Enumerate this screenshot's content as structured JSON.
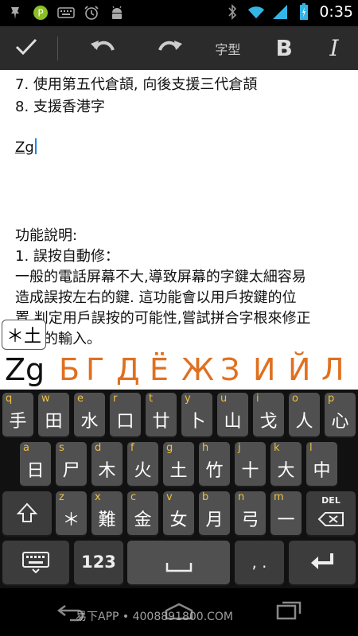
{
  "status": {
    "time": "0:35",
    "battery_color": "#33b5e5"
  },
  "toolbar": {
    "font_label": "字型",
    "bold_label": "B",
    "italic_label": "I"
  },
  "document": {
    "lines": [
      "7. 使用第五代倉頡, 向後支援三代倉頡",
      "8. 支援香港字",
      "Zg",
      "功能說明:",
      "1. 誤按自動修：",
      "一般的電話屏幕不大,導致屏幕的字鍵太細容易",
      "造成誤按左右的鍵. 這功能會以用戶按鍵的位",
      "置,判定用戶誤按的可能性,嘗試拼合字根來修正",
      "用戶的輸入。"
    ]
  },
  "composing": {
    "text": "＊土"
  },
  "candidates": [
    "Zg",
    "Б",
    "Г",
    "Д",
    "Ё",
    "Ж",
    "З",
    "И",
    "Й",
    "Л"
  ],
  "keyboard": {
    "row1": [
      {
        "hint": "q",
        "label": "手"
      },
      {
        "hint": "w",
        "label": "田"
      },
      {
        "hint": "e",
        "label": "水"
      },
      {
        "hint": "r",
        "label": "口"
      },
      {
        "hint": "t",
        "label": "廿"
      },
      {
        "hint": "y",
        "label": "卜"
      },
      {
        "hint": "u",
        "label": "山"
      },
      {
        "hint": "i",
        "label": "戈"
      },
      {
        "hint": "o",
        "label": "人"
      },
      {
        "hint": "p",
        "label": "心"
      }
    ],
    "row2": [
      {
        "hint": "a",
        "label": "日"
      },
      {
        "hint": "s",
        "label": "尸"
      },
      {
        "hint": "d",
        "label": "木"
      },
      {
        "hint": "f",
        "label": "火"
      },
      {
        "hint": "g",
        "label": "土"
      },
      {
        "hint": "h",
        "label": "竹"
      },
      {
        "hint": "j",
        "label": "十"
      },
      {
        "hint": "k",
        "label": "大"
      },
      {
        "hint": "l",
        "label": "中"
      }
    ],
    "row3": [
      {
        "hint": "z",
        "label": "＊"
      },
      {
        "hint": "x",
        "label": "難"
      },
      {
        "hint": "c",
        "label": "金"
      },
      {
        "hint": "v",
        "label": "女"
      },
      {
        "hint": "b",
        "label": "月"
      },
      {
        "hint": "n",
        "label": "弓"
      },
      {
        "hint": "m",
        "label": "一"
      }
    ],
    "del_label": "DEL",
    "num_label": "123",
    "punct_label": ", ."
  },
  "watermark": "易下APP • 4008891800.COM"
}
